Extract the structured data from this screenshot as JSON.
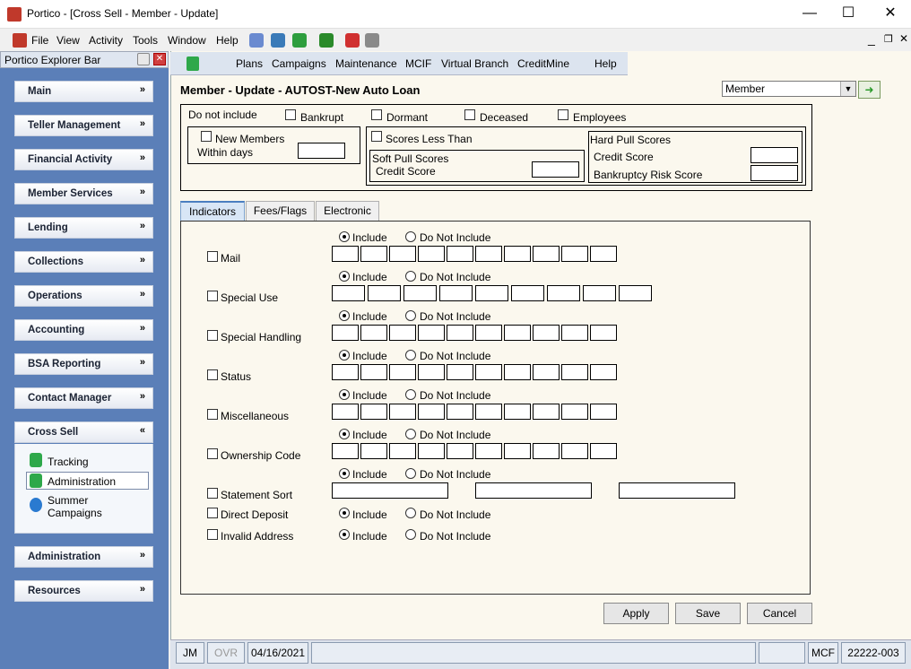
{
  "window": {
    "title": "Portico - [Cross Sell - Member - Update]",
    "min": "—",
    "max": "☐",
    "close": "✕"
  },
  "menu": [
    "File",
    "View",
    "Activity",
    "Tools",
    "Window",
    "Help"
  ],
  "explorer": {
    "title": "Portico Explorer Bar",
    "sections": [
      {
        "label": "Main"
      },
      {
        "label": "Teller Management"
      },
      {
        "label": "Financial Activity"
      },
      {
        "label": "Member Services"
      },
      {
        "label": "Lending"
      },
      {
        "label": "Collections"
      },
      {
        "label": "Operations"
      },
      {
        "label": "Accounting"
      },
      {
        "label": "BSA Reporting"
      },
      {
        "label": "Contact Manager"
      },
      {
        "label": "Cross Sell"
      },
      {
        "label": "Administration"
      },
      {
        "label": "Resources"
      }
    ],
    "cross_sell_items": [
      "Tracking",
      "Administration",
      "Summer",
      "Campaigns"
    ]
  },
  "nav": [
    "Plans",
    "Campaigns",
    "Maintenance",
    "MCIF",
    "Virtual Branch",
    "CreditMine",
    "Help"
  ],
  "heading": "Member - Update - AUTOST-New Auto Loan",
  "member_select": "Member",
  "filters": {
    "do_not_include": "Do not include",
    "bankrupt": "Bankrupt",
    "dormant": "Dormant",
    "deceased": "Deceased",
    "employees": "Employees",
    "new_members": "New Members",
    "within_days": "Within days",
    "scores_less_than": "Scores Less Than",
    "soft_pull": "Soft Pull Scores",
    "soft_credit": "Credit Score",
    "hard_pull": "Hard Pull Scores",
    "hard_credit": "Credit Score",
    "bankruptcy_risk": "Bankruptcy Risk Score"
  },
  "tabs": [
    "Indicators",
    "Fees/Flags",
    "Electronic"
  ],
  "include_label": "Include",
  "exclude_label": "Do Not Include",
  "indicators": [
    "Mail",
    "Special Use",
    "Special Handling",
    "Status",
    "Miscellaneous",
    "Ownership Code",
    "Statement Sort",
    "Direct Deposit",
    "Invalid Address"
  ],
  "buttons": {
    "apply": "Apply",
    "save": "Save",
    "cancel": "Cancel"
  },
  "status": {
    "user": "JM",
    "ovr": "OVR",
    "date": "04/16/2021",
    "mcf": "MCF",
    "id": "22222-003"
  }
}
